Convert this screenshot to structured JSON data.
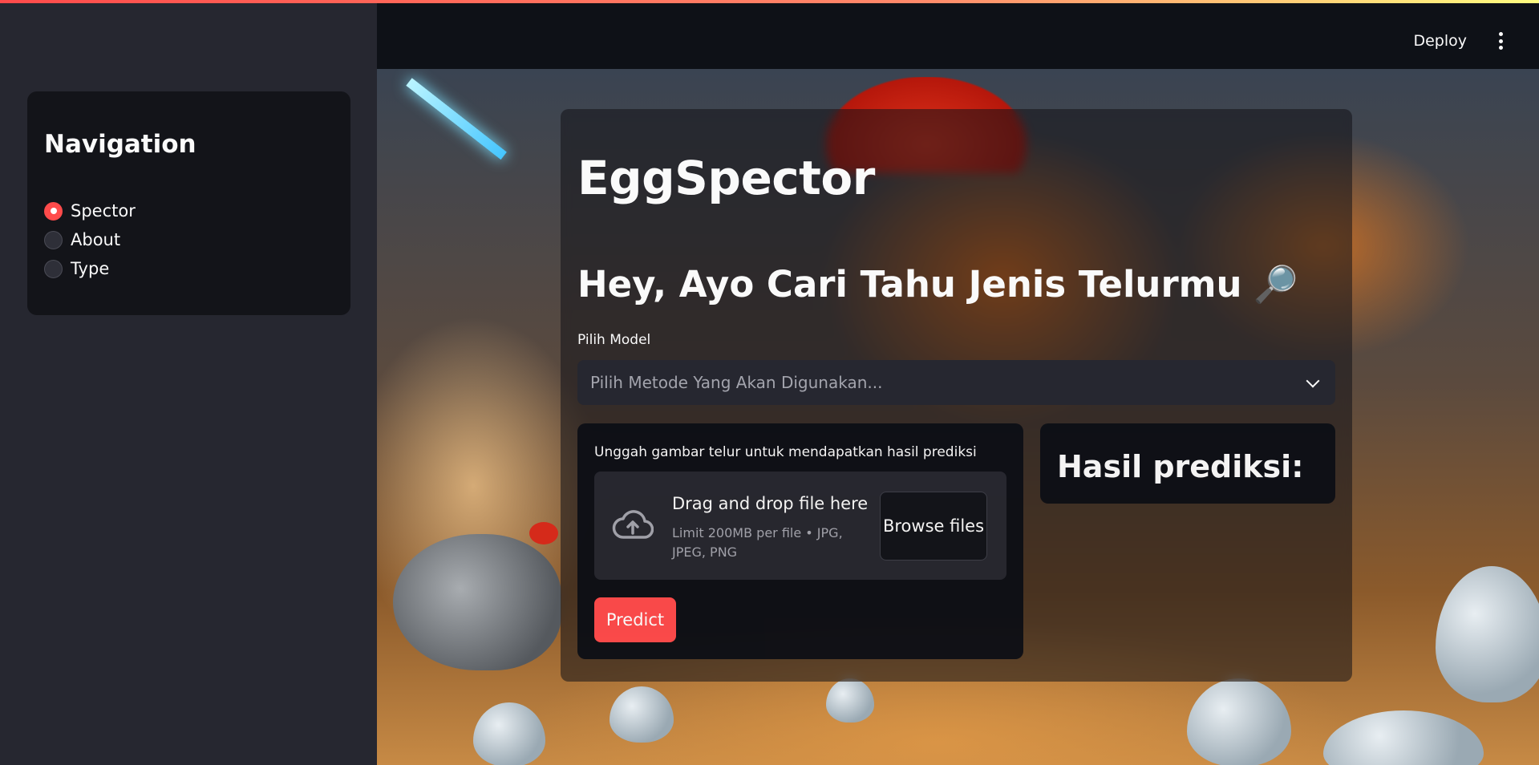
{
  "sidebar": {
    "title": "Navigation",
    "items": [
      {
        "label": "Spector",
        "selected": true
      },
      {
        "label": "About",
        "selected": false
      },
      {
        "label": "Type",
        "selected": false
      }
    ]
  },
  "header": {
    "deploy_label": "Deploy",
    "menu_icon": "kebab-menu-icon"
  },
  "main": {
    "title": "EggSpector",
    "subtitle": "Hey, Ayo Cari Tahu Jenis Telurmu",
    "subtitle_emoji": "🔎",
    "model_select": {
      "label": "Pilih Model",
      "placeholder": "Pilih Metode Yang Akan Digunakan..."
    },
    "uploader": {
      "label": "Unggah gambar telur untuk mendapatkan hasil prediksi",
      "drop_text": "Drag and drop file here",
      "limit_text": "Limit 200MB per file • JPG, JPEG, PNG",
      "browse_label": "Browse files",
      "icon": "cloud-upload-icon"
    },
    "predict_label": "Predict",
    "result_title": "Hasil prediksi:"
  },
  "colors": {
    "accent": "#ff4b4b",
    "sidebar_bg": "#262730",
    "app_bg": "#0e1117"
  }
}
